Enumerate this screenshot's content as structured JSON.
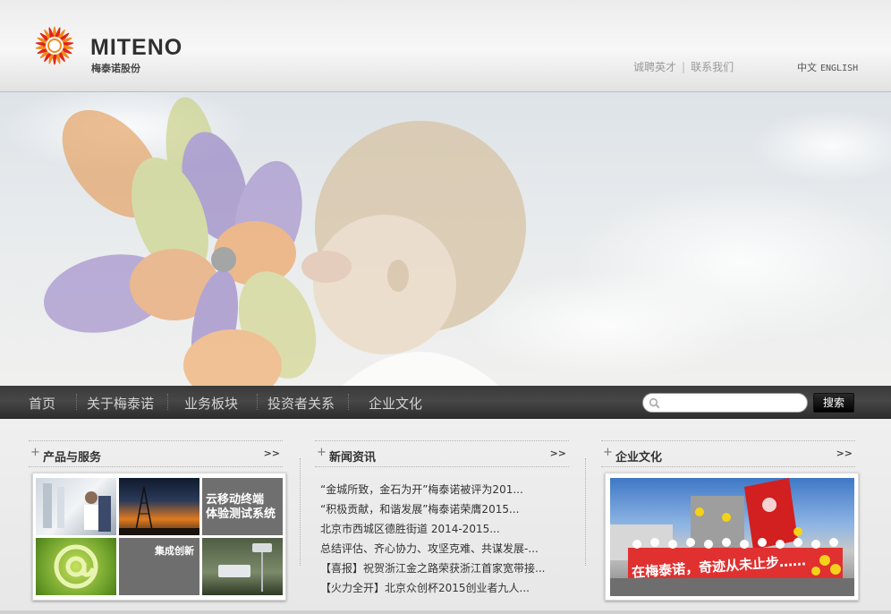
{
  "header": {
    "logo_en": "MITENO",
    "logo_cn": "梅泰诺股份",
    "links": [
      "诚聘英才",
      "联系我们"
    ],
    "link_separator": "|",
    "lang": [
      "中文",
      "ENGLISH"
    ]
  },
  "nav": {
    "items": [
      "首页",
      "关于梅泰诺",
      "业务板块",
      "投资者关系",
      "企业文化"
    ],
    "search_placeholder": "",
    "search_button": "搜索"
  },
  "panels": {
    "products": {
      "title": "产品与服务",
      "more": ">>",
      "tile_cloud_line1": "云移动终端",
      "tile_cloud_line2": "体验测试系统",
      "tile_integration": "集成创新"
    },
    "news": {
      "title": "新闻资讯",
      "more": ">>",
      "items": [
        "“金城所致，金石为开”梅泰诺被评为201...",
        "“积极贡献，和谐发展”梅泰诺荣膺2015...",
        "北京市西城区德胜街道 2014-2015...",
        "总结评估、齐心协力、攻坚克难、共谋发展-...",
        "【喜报】祝贺浙江金之路荣获浙江首家宽带接...",
        "【火力全开】北京众创杯2015创业者九人..."
      ]
    },
    "culture": {
      "title": "企业文化",
      "more": ">>",
      "banner_text": "在梅泰诺，奇迹从未止步……"
    }
  },
  "colors": {
    "nav_bg": "#3a3a3a",
    "logo_orange": "#f08a1c",
    "logo_red": "#e2231a",
    "banner_red": "#d62020"
  },
  "icons": [
    "sun-logo-icon",
    "search-icon"
  ]
}
